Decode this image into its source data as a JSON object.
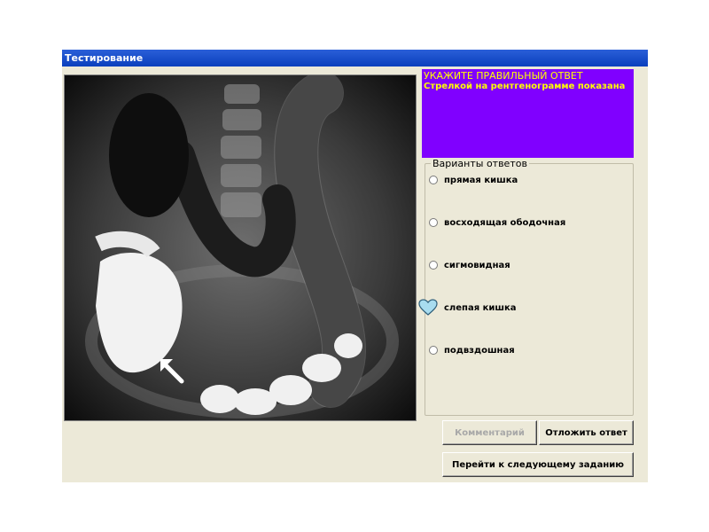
{
  "window": {
    "title": "Тестирование"
  },
  "question": {
    "heading": "УКАЖИТЕ ПРАВИЛЬНЫЙ ОТВЕТ",
    "text": "Стрелкой на рентгенограмме показана",
    "panel_color": "#8000ff",
    "text_color": "#ffff00"
  },
  "answers": {
    "legend": "Варианты ответов",
    "options": [
      {
        "label": "прямая кишка",
        "selected": false
      },
      {
        "label": "восходящая ободочная",
        "selected": false
      },
      {
        "label": "сигмовидная",
        "selected": false
      },
      {
        "label": "слепая кишка",
        "selected": false,
        "hovered": true
      },
      {
        "label": "подвздошная",
        "selected": false
      }
    ]
  },
  "buttons": {
    "comment": "Комментарий",
    "postpone": "Отложить ответ",
    "next": "Перейти к следующему заданию"
  },
  "image": {
    "icon": "heart-cursor-icon",
    "accent_arrow": "white-arrow-icon"
  }
}
